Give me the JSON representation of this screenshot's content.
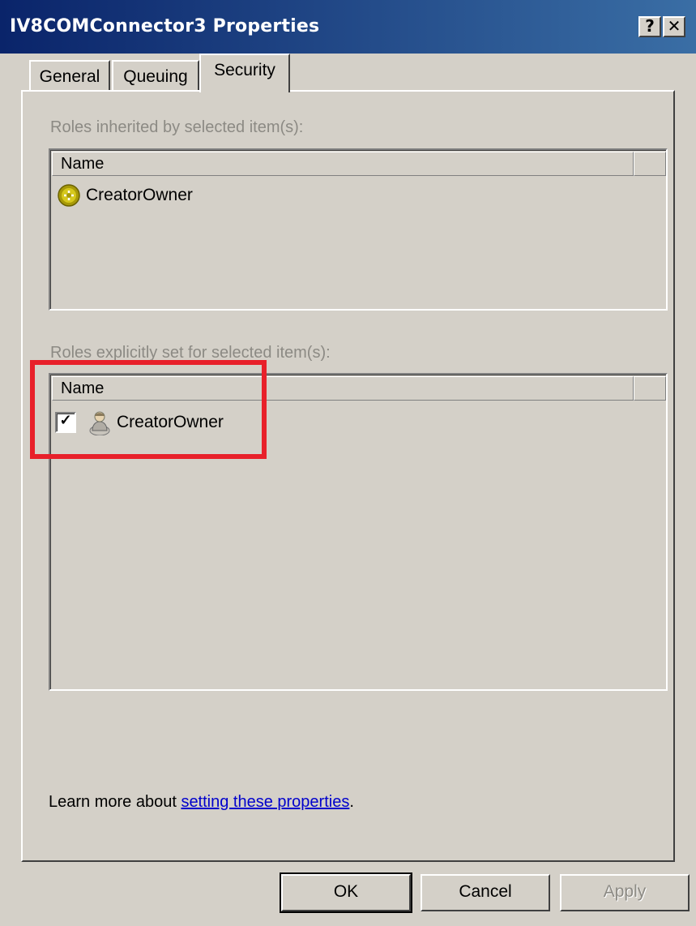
{
  "window": {
    "title": "IV8COMConnector3 Properties",
    "help_button": "?",
    "close_button": "✕"
  },
  "tabs": [
    {
      "label": "General"
    },
    {
      "label": "Queuing"
    },
    {
      "label": "Security",
      "active": true
    }
  ],
  "inherited": {
    "label": "Roles inherited by selected item(s):",
    "column": "Name",
    "items": [
      {
        "name": "CreatorOwner",
        "icon": "role-icon"
      }
    ]
  },
  "explicit": {
    "label": "Roles explicitly set for selected item(s):",
    "column": "Name",
    "items": [
      {
        "name": "CreatorOwner",
        "checked": true,
        "check_mark": "✓",
        "icon": "user-icon"
      }
    ]
  },
  "learn_more": {
    "prefix": "Learn more about ",
    "link": "setting these properties",
    "suffix": "."
  },
  "buttons": {
    "ok": "OK",
    "cancel": "Cancel",
    "apply": "Apply"
  },
  "colors": {
    "highlight": "#e8202a",
    "titlebar": "#0a246a",
    "link": "#0000cc"
  }
}
